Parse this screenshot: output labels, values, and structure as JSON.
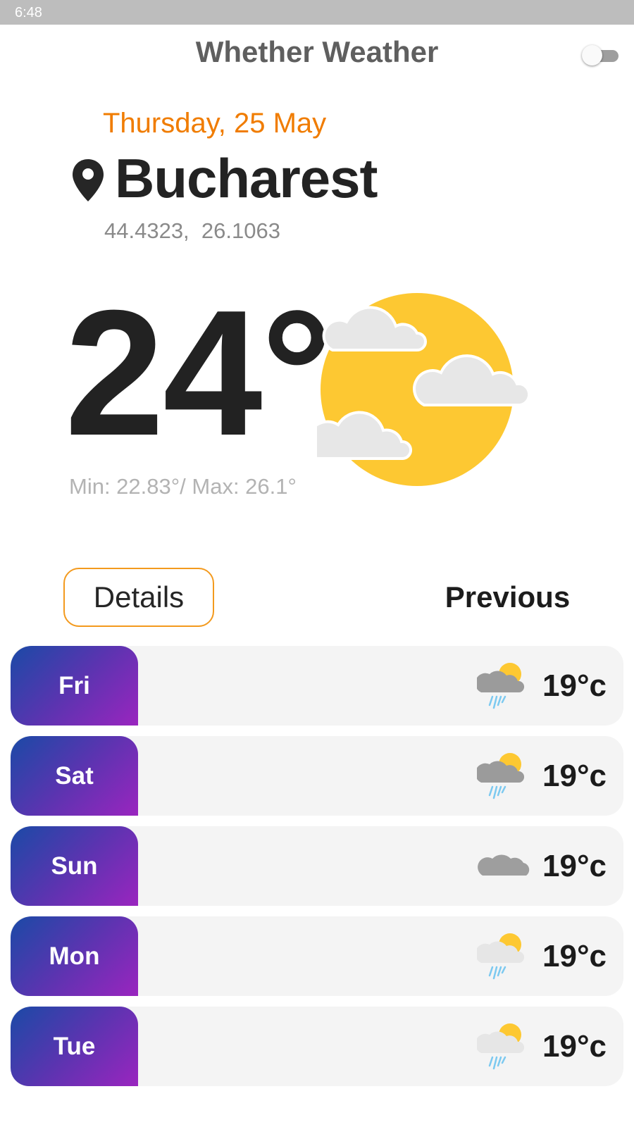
{
  "status_bar": {
    "time": "6:48"
  },
  "app": {
    "title": "Whether Weather",
    "theme_toggle_on": false
  },
  "current": {
    "date": "Thursday, 25 May",
    "city": "Bucharest",
    "coordinates": "44.4323,  26.1063",
    "temperature": "24°",
    "min_max": "Min: 22.83°/ Max: 26.1°",
    "icon": "sun-with-clouds-icon"
  },
  "tabs": {
    "details": "Details",
    "previous": "Previous"
  },
  "forecast": [
    {
      "day": "Fri",
      "temp": "19°c",
      "icon": "sun-cloud-rain-icon"
    },
    {
      "day": "Sat",
      "temp": "19°c",
      "icon": "sun-cloud-rain-icon"
    },
    {
      "day": "Sun",
      "temp": "19°c",
      "icon": "cloud-icon"
    },
    {
      "day": "Mon",
      "temp": "19°c",
      "icon": "sun-light-cloud-rain-icon"
    },
    {
      "day": "Tue",
      "temp": "19°c",
      "icon": "sun-light-cloud-rain-icon"
    }
  ],
  "colors": {
    "accent_orange": "#f07c00",
    "sun_yellow": "#fdc832",
    "day_gradient_start": "#1a4aa6",
    "day_gradient_end": "#9a25bf"
  }
}
